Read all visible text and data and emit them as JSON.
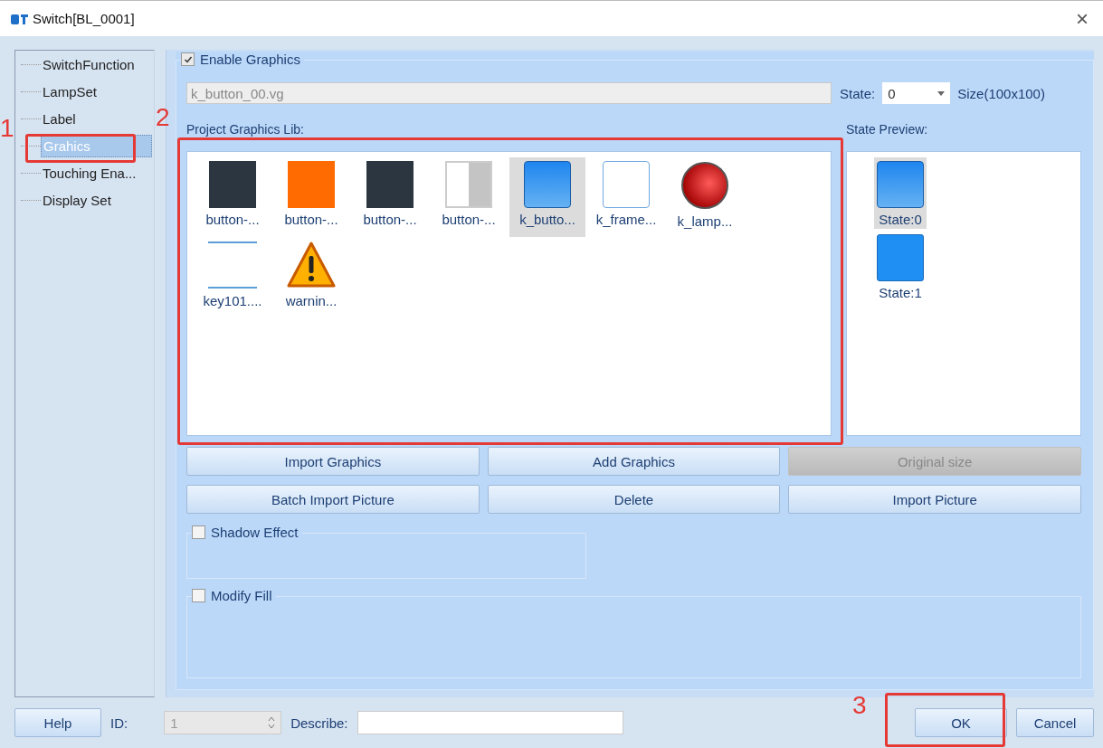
{
  "window": {
    "title": "Switch[BL_0001]",
    "close": "×"
  },
  "sidebar": {
    "items": [
      {
        "label": "SwitchFunction",
        "selected": false
      },
      {
        "label": "LampSet",
        "selected": false
      },
      {
        "label": "Label",
        "selected": false
      },
      {
        "label": "Grahics",
        "selected": true
      },
      {
        "label": "Touching Ena...",
        "selected": false
      },
      {
        "label": "Display Set",
        "selected": false
      }
    ]
  },
  "graphics": {
    "enable_label": "Enable Graphics",
    "enabled": true,
    "file": "k_button_00.vg",
    "state_label": "State:",
    "state_value": "0",
    "size": "Size(100x100)",
    "lib_label": "Project Graphics Lib:",
    "preview_label": "State Preview:",
    "library": [
      {
        "kind": "dark",
        "label": "button-...",
        "selected": false
      },
      {
        "kind": "orange",
        "label": "button-...",
        "selected": false
      },
      {
        "kind": "dark",
        "label": "button-...",
        "selected": false
      },
      {
        "kind": "half",
        "label": "button-...",
        "selected": false
      },
      {
        "kind": "blue",
        "label": "k_butto...",
        "selected": true
      },
      {
        "kind": "frame",
        "label": "k_frame...",
        "selected": false
      },
      {
        "kind": "lamp",
        "label": "k_lamp...",
        "selected": false
      },
      {
        "kind": "line",
        "label": "key101....",
        "selected": false
      },
      {
        "kind": "warning",
        "label": "warnin...",
        "selected": false
      }
    ],
    "states": [
      {
        "kind": "blue",
        "label": "State:0",
        "selected": true
      },
      {
        "kind": "flat",
        "label": "State:1",
        "selected": false
      }
    ],
    "buttons": [
      {
        "label": "Import Graphics",
        "disabled": false
      },
      {
        "label": "Add Graphics",
        "disabled": false
      },
      {
        "label": "Original size",
        "disabled": true
      },
      {
        "label": "Batch Import Picture",
        "disabled": false
      },
      {
        "label": "Delete",
        "disabled": false
      },
      {
        "label": "Import Picture",
        "disabled": false
      }
    ],
    "shadow": {
      "label": "Shadow Effect",
      "checked": false
    },
    "fill": {
      "label": "Modify Fill",
      "checked": false
    }
  },
  "footer": {
    "help": "Help",
    "id_label": "ID:",
    "id_value": "1",
    "describe_label": "Describe:",
    "ok": "OK",
    "cancel": "Cancel"
  },
  "annotations": [
    {
      "label": "1"
    },
    {
      "label": "2"
    },
    {
      "label": "3"
    }
  ]
}
